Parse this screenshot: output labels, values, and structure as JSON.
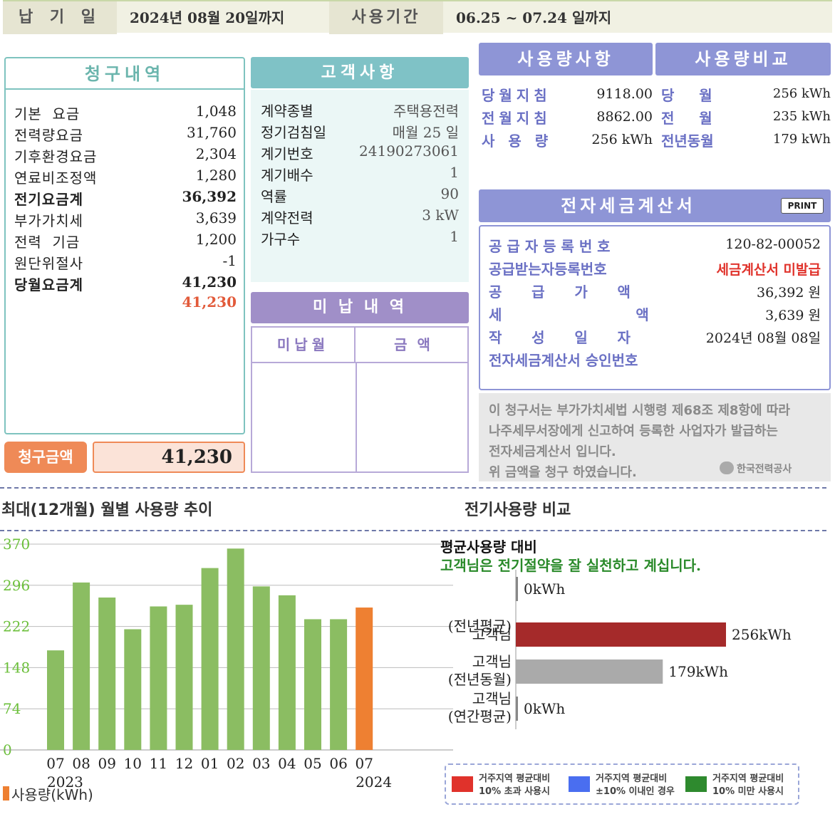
{
  "top": {
    "due_label": "납 기 일",
    "due_value": "2024년 08월 20일까지",
    "period_label": "사용기간",
    "period_value": "06.25 ~ 07.24 일까지"
  },
  "billing": {
    "title": "청구내역",
    "items": [
      {
        "label": "기본  요금",
        "value": "1,048",
        "bold": false
      },
      {
        "label": "전력량요금",
        "value": "31,760",
        "bold": false
      },
      {
        "label": "기후환경요금",
        "value": "2,304",
        "bold": false
      },
      {
        "label": "연료비조정액",
        "value": "1,280",
        "bold": false
      },
      {
        "label": "전기요금계",
        "value": "36,392",
        "bold": true
      },
      {
        "label": "부가가치세",
        "value": "3,639",
        "bold": false
      },
      {
        "label": "전력  기금",
        "value": "1,200",
        "bold": false
      },
      {
        "label": "원단위절사",
        "value": "-1",
        "bold": false
      },
      {
        "label": "당월요금계",
        "value": "41,230",
        "bold": true
      }
    ],
    "total_red": "41,230",
    "claim_label": "청구금액",
    "claim_value": "41,230"
  },
  "customer": {
    "title": "고객사항",
    "items": [
      {
        "label": "계약종별",
        "value": "주택용전력"
      },
      {
        "label": "정기검침일",
        "value": "매월 25 일"
      },
      {
        "label": "계기번호",
        "value": "24190273061"
      },
      {
        "label": "계기배수",
        "value": "1"
      },
      {
        "label": "역률",
        "value": "90"
      },
      {
        "label": "계약전력",
        "value": "3 kW"
      },
      {
        "label": "가구수",
        "value": "1"
      }
    ]
  },
  "unpaid": {
    "title": "미 납 내 역",
    "col_month": "미납월",
    "col_amount": "금  액"
  },
  "usage": {
    "title": "사용량사항",
    "items": [
      {
        "label": "당월지침",
        "value": "9118.00"
      },
      {
        "label": "전월지침",
        "value": "8862.00"
      },
      {
        "label": "사 용 량",
        "value": "256 kWh"
      }
    ]
  },
  "compare": {
    "title": "사용량비교",
    "items": [
      {
        "label": "당     월",
        "value": "256 kWh"
      },
      {
        "label": "전     월",
        "value": "235 kWh"
      },
      {
        "label": "전년동월",
        "value": "179 kWh"
      }
    ]
  },
  "tax": {
    "title": "전자세금계산서",
    "print_label": "PRINT",
    "items": [
      {
        "label": "공 급 자 등 록 번 호",
        "value": "120-82-00052",
        "red": false
      },
      {
        "label": "공급받는자등록번호",
        "value": "세금계산서 미발급",
        "red": true
      },
      {
        "label": "공      급      가      액",
        "value": "36,392 원",
        "red": false
      },
      {
        "label": "세                           액",
        "value": "3,639 원",
        "red": false
      },
      {
        "label": "작      성      일      자",
        "value": "2024년 08월 08일",
        "red": false
      },
      {
        "label": "전자세금계산서 승인번호",
        "value": "",
        "red": false
      }
    ]
  },
  "notice": {
    "lines": [
      "이 청구서는 부가가치세법 시행령 제68조 제8항에 따라",
      "나주세무서장에게 신고하여 등록한 사업자가 발급하는",
      "전자세금계산서 입니다.",
      "위 금액을 청구 하였습니다."
    ],
    "logo_text": "한국전력공사"
  },
  "trend": {
    "title": "최대(12개월) 월별 사용량 추이",
    "legend": "사용량(kWh)"
  },
  "elec_compare": {
    "title": "전기사용량 비교",
    "subtitle": "평균사용량 대비",
    "message": "고객님은 전기절약을 잘 실천하고 계십니다.",
    "legend": [
      {
        "line1": "거주지역 평균대비",
        "line2": "10% 초과 사용시",
        "color": "#e0322b"
      },
      {
        "line1": "거주지역 평균대비",
        "line2": "±10% 이내인 경우",
        "color": "#4a6ef0"
      },
      {
        "line1": "거주지역 평균대비",
        "line2": "10% 미만 사용시",
        "color": "#2e8a2e"
      }
    ]
  },
  "chart_data": [
    {
      "type": "bar",
      "title": "최대(12개월) 월별 사용량 추이",
      "categories": [
        "07",
        "08",
        "09",
        "10",
        "11",
        "12",
        "01",
        "02",
        "03",
        "04",
        "05",
        "06",
        "07"
      ],
      "year_labels": [
        {
          "index": 0,
          "label": "2023"
        },
        {
          "index": 12,
          "label": "2024"
        }
      ],
      "series": [
        {
          "name": "사용량(kWh)",
          "values": [
            179,
            301,
            274,
            217,
            258,
            261,
            327,
            362,
            294,
            278,
            235,
            235,
            256
          ]
        }
      ],
      "yticks": [
        0,
        74,
        148,
        222,
        296,
        370
      ],
      "ylim": [
        0,
        370
      ],
      "colors": {
        "past": "#8bbd62",
        "current": "#ee8032"
      },
      "grid": true
    },
    {
      "type": "bar",
      "orientation": "horizontal",
      "categories": [
        "(전년평균)",
        "고객님",
        "고객님\n(전년동월)",
        "고객님\n(연간평균)"
      ],
      "values": [
        0,
        256,
        179,
        0
      ],
      "value_labels": [
        "0kWh",
        "256kWh",
        "179kWh",
        "0kWh"
      ],
      "colors": [
        "#888888",
        "#a52a2a",
        "#aaaaaa",
        "#888888"
      ]
    }
  ]
}
